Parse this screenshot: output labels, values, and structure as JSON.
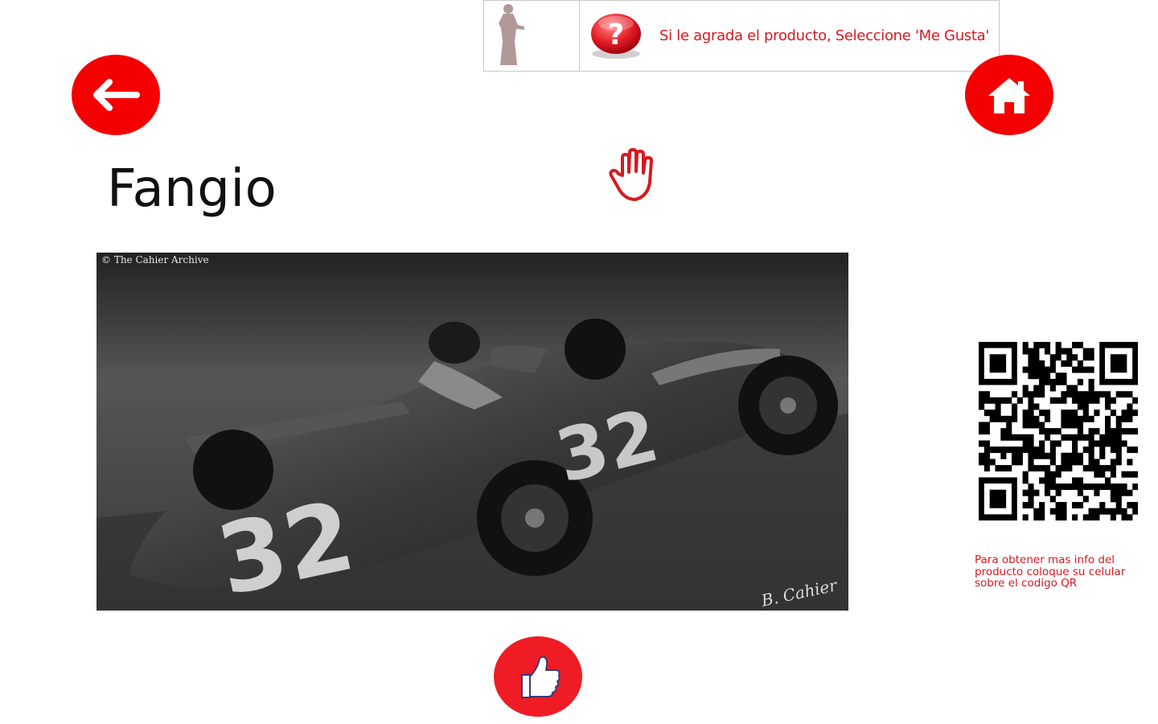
{
  "hint": {
    "text": "Si le agrada el producto, Seleccione 'Me Gusta'",
    "figure_icon": "standing-person-figure",
    "question_icon": "question-mark-button"
  },
  "nav": {
    "back_icon": "arrow-left-icon",
    "home_icon": "house-icon"
  },
  "gesture_icon": "open-hand-icon",
  "product": {
    "title": "Fangio",
    "photo": {
      "caption": "© The Cahier Archive",
      "car_number": "32",
      "signature": "B. Cahier"
    }
  },
  "qr": {
    "icon": "qr-code",
    "info_text": "Para obtener mas info del producto coloque su celular sobre el codigo QR"
  },
  "like_icon": "thumbs-up-icon",
  "colors": {
    "accent_red": "#f50000",
    "text_red": "#d71920"
  }
}
